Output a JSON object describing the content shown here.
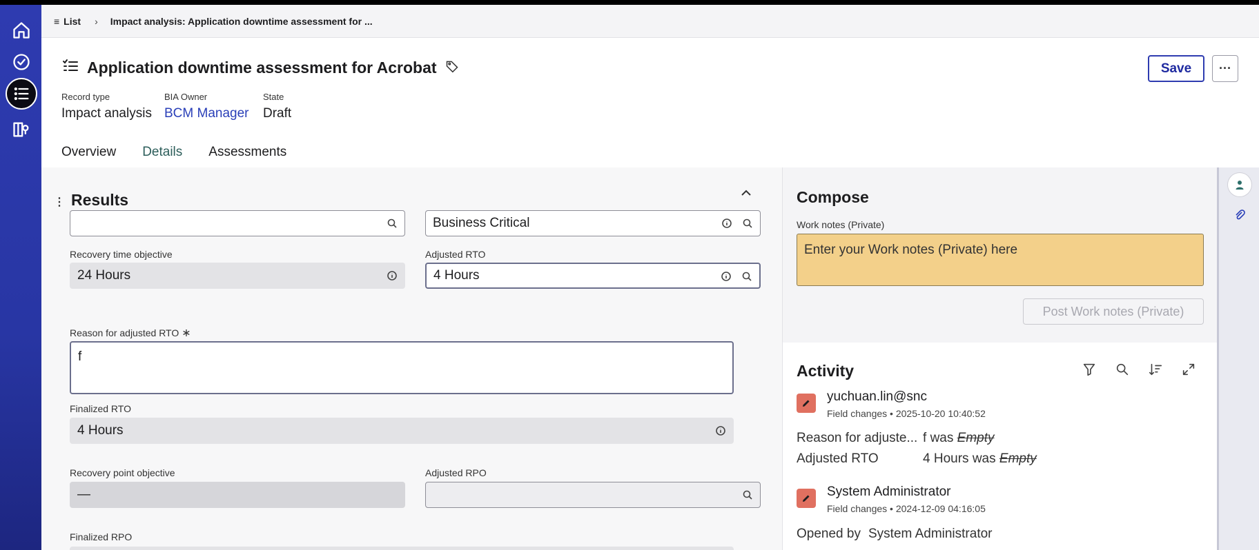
{
  "breadcrumb": {
    "list_label": "List",
    "current": "Impact analysis: Application downtime assessment for ..."
  },
  "header": {
    "title": "Application downtime assessment for Acrobat",
    "record_type_label": "Record type",
    "record_type_value": "Impact analysis",
    "owner_label": "BIA Owner",
    "owner_value": "BCM Manager",
    "state_label": "State",
    "state_value": "Draft",
    "save_label": "Save",
    "more_label": "···"
  },
  "tabs": [
    {
      "label": "Overview"
    },
    {
      "label": "Details"
    },
    {
      "label": "Assessments"
    }
  ],
  "results": {
    "title": "Results",
    "top_left_value": "",
    "top_right_value": "Business Critical",
    "rto_label": "Recovery time objective",
    "rto_value": "24 Hours",
    "adjusted_rto_label": "Adjusted RTO",
    "adjusted_rto_value": "4 Hours",
    "reason_label": "Reason for adjusted RTO",
    "reason_required": "∗",
    "reason_value": "f",
    "finalized_rto_label": "Finalized RTO",
    "finalized_rto_value": "4 Hours",
    "rpo_label": "Recovery point objective",
    "rpo_value": "—",
    "adjusted_rpo_label": "Adjusted RPO",
    "adjusted_rpo_value": "",
    "finalized_rpo_label": "Finalized RPO"
  },
  "compose": {
    "title": "Compose",
    "work_notes_label": "Work notes (Private)",
    "work_notes_placeholder": "Enter your Work notes (Private) here",
    "post_label": "Post Work notes (Private)"
  },
  "activity": {
    "title": "Activity",
    "entries": [
      {
        "user": "yuchuan.lin@snc",
        "type": "Field changes",
        "timestamp": "2025-10-20 10:40:52",
        "changes": [
          {
            "field": "Reason for adjuste...",
            "value": "f",
            "was": "was",
            "old": "Empty"
          },
          {
            "field": "Adjusted RTO",
            "value": "4 Hours",
            "was": "was",
            "old": "Empty"
          }
        ]
      },
      {
        "user": "System Administrator",
        "type": "Field changes",
        "timestamp": "2024-12-09 04:16:05",
        "changes": [
          {
            "field": "Opened by",
            "value": "System Administrator"
          }
        ]
      }
    ]
  },
  "colors": {
    "rail": "#2e3bb0",
    "accent_tab": "#2d6f6b",
    "work_notes_bg": "#f3d08a",
    "link": "#2a3fb8"
  }
}
